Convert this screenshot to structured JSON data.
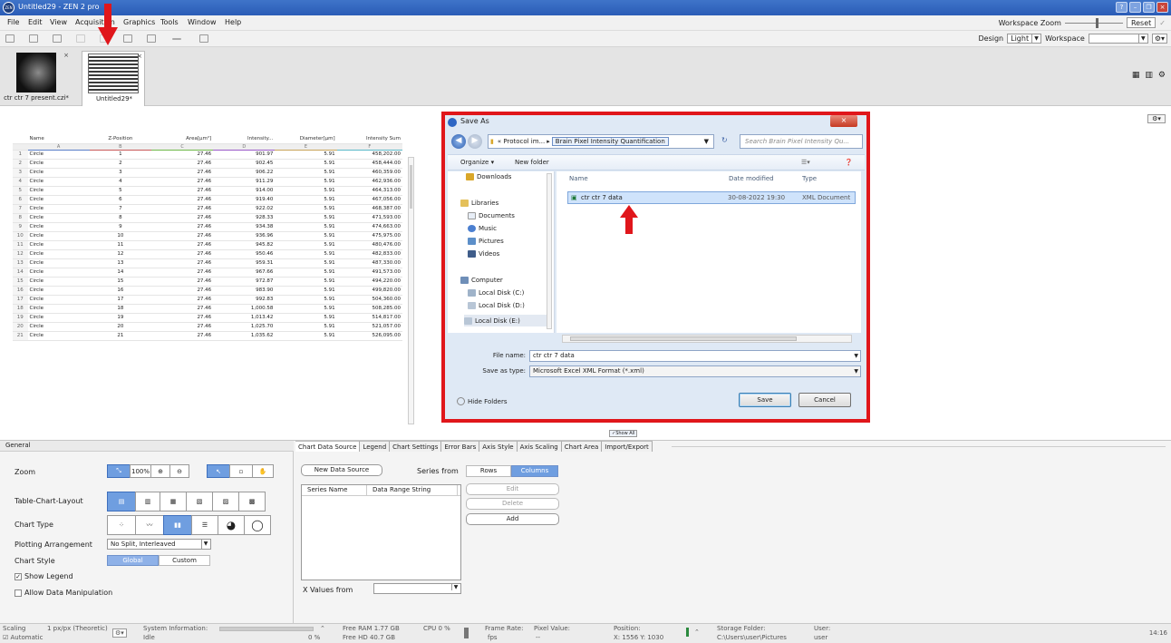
{
  "window": {
    "title": "Untitled29 - ZEN 2 pro",
    "logo": "ZEN"
  },
  "menu": {
    "items": [
      "File",
      "Edit",
      "View",
      "Acquisition",
      "Graphics",
      "Tools",
      "Window",
      "Help"
    ],
    "workspace_zoom_label": "Workspace Zoom",
    "reset_label": "Reset"
  },
  "toolbar": {
    "design_label": "Design",
    "design_value": "Light",
    "workspace_label": "Workspace",
    "workspace_value": ""
  },
  "documents": [
    {
      "label": "ctr ctr 7 present.czi*"
    },
    {
      "label": "Untitled29*"
    }
  ],
  "table": {
    "headers": [
      "Name",
      "Z-Position",
      "Area[µm²]",
      "Intensity...",
      "Diameter[µm]",
      "Intensity Sum"
    ],
    "letters": [
      "A",
      "B",
      "C",
      "D",
      "E",
      "F"
    ],
    "rows": [
      [
        "1",
        "Circle",
        "1",
        "27.46",
        "901.97",
        "5.91",
        "458,202.00"
      ],
      [
        "2",
        "Circle",
        "2",
        "27.46",
        "902.45",
        "5.91",
        "458,444.00"
      ],
      [
        "3",
        "Circle",
        "3",
        "27.46",
        "906.22",
        "5.91",
        "460,359.00"
      ],
      [
        "4",
        "Circle",
        "4",
        "27.46",
        "911.29",
        "5.91",
        "462,936.00"
      ],
      [
        "5",
        "Circle",
        "5",
        "27.46",
        "914.00",
        "5.91",
        "464,313.00"
      ],
      [
        "6",
        "Circle",
        "6",
        "27.46",
        "919.40",
        "5.91",
        "467,056.00"
      ],
      [
        "7",
        "Circle",
        "7",
        "27.46",
        "922.02",
        "5.91",
        "468,387.00"
      ],
      [
        "8",
        "Circle",
        "8",
        "27.46",
        "928.33",
        "5.91",
        "471,593.00"
      ],
      [
        "9",
        "Circle",
        "9",
        "27.46",
        "934.38",
        "5.91",
        "474,663.00"
      ],
      [
        "10",
        "Circle",
        "10",
        "27.46",
        "936.96",
        "5.91",
        "475,975.00"
      ],
      [
        "11",
        "Circle",
        "11",
        "27.46",
        "945.82",
        "5.91",
        "480,476.00"
      ],
      [
        "12",
        "Circle",
        "12",
        "27.46",
        "950.46",
        "5.91",
        "482,833.00"
      ],
      [
        "13",
        "Circle",
        "13",
        "27.46",
        "959.31",
        "5.91",
        "487,330.00"
      ],
      [
        "14",
        "Circle",
        "14",
        "27.46",
        "967.66",
        "5.91",
        "491,573.00"
      ],
      [
        "15",
        "Circle",
        "15",
        "27.46",
        "972.87",
        "5.91",
        "494,220.00"
      ],
      [
        "16",
        "Circle",
        "16",
        "27.46",
        "983.90",
        "5.91",
        "499,820.00"
      ],
      [
        "17",
        "Circle",
        "17",
        "27.46",
        "992.83",
        "5.91",
        "504,360.00"
      ],
      [
        "18",
        "Circle",
        "18",
        "27.46",
        "1,000.58",
        "5.91",
        "508,285.00"
      ],
      [
        "19",
        "Circle",
        "19",
        "27.46",
        "1,013.42",
        "5.91",
        "514,817.00"
      ],
      [
        "20",
        "Circle",
        "20",
        "27.46",
        "1,025.70",
        "5.91",
        "521,057.00"
      ],
      [
        "21",
        "Circle",
        "21",
        "27.46",
        "1,035.62",
        "5.91",
        "526,095.00"
      ]
    ]
  },
  "dialog": {
    "title": "Save As",
    "path_parent": "« Protocol im...",
    "path_current": "Brain Pixel Intensity Quantification",
    "search_placeholder": "Search Brain Pixel Intensity Qu...",
    "organize": "Organize ▾",
    "new_folder": "New folder",
    "nav": [
      "Downloads",
      "Libraries",
      "Documents",
      "Music",
      "Pictures",
      "Videos",
      "Computer",
      "Local Disk (C:)",
      "Local Disk (D:)",
      "Local Disk (E:)"
    ],
    "columns": [
      "Name",
      "Date modified",
      "Type"
    ],
    "file": {
      "name": "ctr ctr 7 data",
      "date": "30-08-2022 19:30",
      "type": "XML Document"
    },
    "file_name_label": "File name:",
    "file_name_value": "ctr ctr 7 data",
    "save_type_label": "Save as type:",
    "save_type_value": "Microsoft Excel XML Format (*.xml)",
    "hide_folders": "Hide Folders",
    "save": "Save",
    "cancel": "Cancel"
  },
  "show_all": "Show All",
  "general": {
    "header": "General",
    "zoom_label": "Zoom",
    "zoom_pct": "100%",
    "layout_label": "Table-Chart-Layout",
    "chart_type_label": "Chart Type",
    "plotting_label": "Plotting Arrangement",
    "plotting_value": "No Split, Interleaved",
    "chart_style_label": "Chart Style",
    "style_global": "Global",
    "style_custom": "Custom",
    "show_legend": "Show Legend",
    "allow_manip": "Allow Data Manipulation"
  },
  "chart_tabs": [
    "Chart Data Source",
    "Legend",
    "Chart Settings",
    "Error Bars",
    "Axis Style",
    "Axis Scaling",
    "Chart Area",
    "Import/Export"
  ],
  "data_source": {
    "new_data_source": "New Data Source",
    "series_from": "Series from",
    "rows": "Rows",
    "columns": "Columns",
    "col_series_name": "Series Name",
    "col_range": "Data Range String",
    "edit": "Edit",
    "delete": "Delete",
    "add": "Add",
    "x_values_from": "X Values from"
  },
  "status": {
    "scaling_label": "Scaling",
    "scaling_value": "1 px/px (Theoretic)",
    "automatic": "Automatic",
    "sysinfo_label": "System Information:",
    "sysinfo_value": "Idle",
    "pct": "0 %",
    "free_ram": "Free RAM 1.77 GB",
    "free_hd": "Free HD   40.7 GB",
    "cpu": "CPU 0 %",
    "frame_rate": "Frame Rate:",
    "fps": "fps",
    "pixel_value": "Pixel Value:",
    "pixel_dash": "--",
    "position": "Position:",
    "position_value": "X: 1556  Y: 1030",
    "storage": "Storage Folder:",
    "storage_value": "C:\\Users\\user\\Pictures",
    "user_label": "User:",
    "user_value": "user",
    "time": "14:16"
  }
}
